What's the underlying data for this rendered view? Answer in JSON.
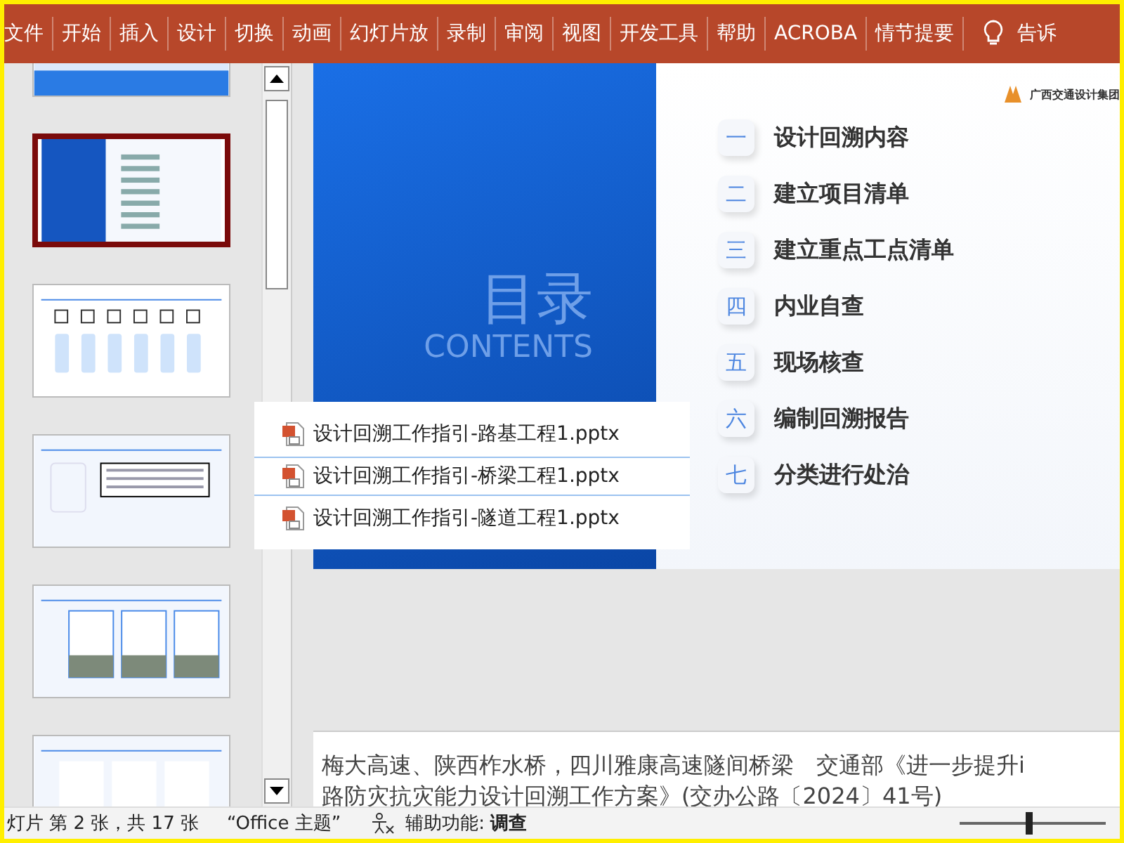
{
  "ribbon": {
    "tabs": [
      {
        "label": "文件",
        "selected": false
      },
      {
        "label": "开始",
        "selected": false
      },
      {
        "label": "插入",
        "selected": false
      },
      {
        "label": "设计",
        "selected": false
      },
      {
        "label": "切换",
        "selected": false
      },
      {
        "label": "动画",
        "selected": false
      },
      {
        "label": "幻灯片放",
        "selected": false
      },
      {
        "label": "录制",
        "selected": false
      },
      {
        "label": "审阅",
        "selected": false
      },
      {
        "label": "视图",
        "selected": false
      },
      {
        "label": "开发工具",
        "selected": false
      },
      {
        "label": "帮助",
        "selected": false
      },
      {
        "label": "ACROBA",
        "selected": false
      },
      {
        "label": "情节提要",
        "selected": false
      }
    ],
    "tell_me": "告诉"
  },
  "thumbnails": [
    {
      "kind": "title",
      "selected": false
    },
    {
      "kind": "contents",
      "selected": true
    },
    {
      "kind": "icons",
      "selected": false
    },
    {
      "kind": "textbox",
      "selected": false
    },
    {
      "kind": "columns",
      "selected": false
    },
    {
      "kind": "cards",
      "selected": false
    }
  ],
  "slide": {
    "title": "目录",
    "subtitle": "CONTENTS",
    "logo_text": "广西交通设计集团",
    "items": [
      {
        "number": "一",
        "label": "设计回溯内容"
      },
      {
        "number": "二",
        "label": "建立项目清单"
      },
      {
        "number": "三",
        "label": "建立重点工点清单"
      },
      {
        "number": "四",
        "label": "内业自查"
      },
      {
        "number": "五",
        "label": "现场核查"
      },
      {
        "number": "六",
        "label": "编制回溯报告"
      },
      {
        "number": "七",
        "label": "分类进行处治"
      }
    ]
  },
  "drop_list": [
    {
      "name": "设计回溯工作指引-路基工程1.pptx",
      "selected": false
    },
    {
      "name": "设计回溯工作指引-桥梁工程1.pptx",
      "selected": true
    },
    {
      "name": "设计回溯工作指引-隧道工程1.pptx",
      "selected": false
    }
  ],
  "notes": [
    "梅大高速、陕西柞水桥，四川雅康高速隧间桥梁　交通部《进一步提升i",
    "路防灾抗灾能力设计回溯工作方案》(交办公路〔2024〕41号)"
  ],
  "status_bar": {
    "slide_info": "灯片 第 2 张，共 17 张",
    "theme": "“Office 主题”",
    "accessibility": "辅助功能: **调查**",
    "zoom_slider": {
      "level": 0.45
    }
  }
}
